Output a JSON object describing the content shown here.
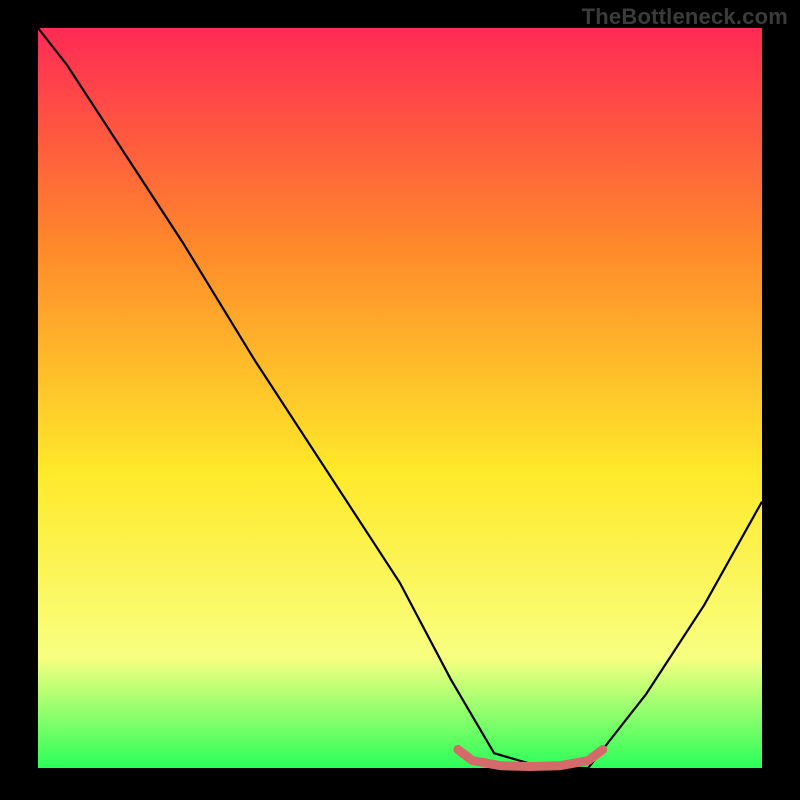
{
  "watermark": "TheBottleneck.com",
  "chart_data": {
    "type": "line",
    "title": "",
    "xlabel": "",
    "ylabel": "",
    "xlim": [
      0,
      100
    ],
    "ylim": [
      0,
      100
    ],
    "background_gradient": {
      "top_color": "#ff2a55",
      "mid_upper_color": "#ff8a2a",
      "mid_color": "#ffe92a",
      "lower_color": "#f8ff80",
      "bottom_color": "#2aff5a"
    },
    "series": [
      {
        "name": "bottleneck-curve",
        "color": "#000000",
        "x": [
          0,
          4,
          10,
          20,
          30,
          40,
          50,
          57,
          63,
          70,
          76,
          84,
          92,
          100
        ],
        "y": [
          100,
          95,
          86,
          71,
          55,
          40,
          25,
          12,
          2,
          0,
          0,
          10,
          22,
          36
        ]
      }
    ],
    "highlight": {
      "name": "optimal-range",
      "color": "#d46a6a",
      "x": [
        58,
        60,
        64,
        68,
        72,
        76,
        78
      ],
      "y": [
        2.5,
        1.0,
        0.3,
        0.2,
        0.3,
        1.0,
        2.5
      ]
    }
  }
}
